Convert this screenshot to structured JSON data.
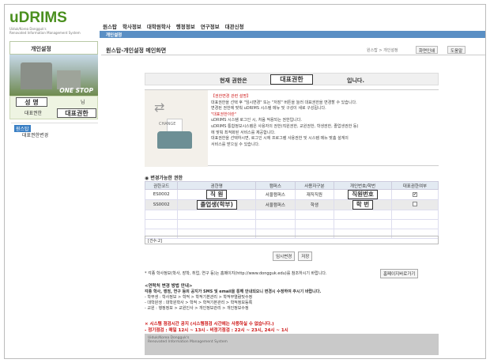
{
  "logo": {
    "name": "uDRIMS",
    "sub1": "Uiduk/Korea Dongguk's",
    "sub2": "Renovated Information Management System"
  },
  "topmenu": [
    "원스탑",
    "학사정보",
    "대학원학사",
    "행정정보",
    "연구정보",
    "대관신청"
  ],
  "navbar": "개인설정",
  "sidebar": {
    "title": "개인설정",
    "photo_caption": "ONE STOP",
    "name": "성 명",
    "name_suffix": "님",
    "role_label": "대표권한",
    "role_value": "대표권한",
    "tree": [
      "원스탑",
      "대표권한변경"
    ]
  },
  "header": {
    "title": "원스탑-개인설정 메인화면",
    "crumb": "원스탑 > 개인설정",
    "buttons": [
      "화면인쇄",
      "도움말"
    ]
  },
  "rolebar": {
    "prefix": "현재 권한은",
    "value": "대표권한",
    "suffix": "입니다."
  },
  "info": {
    "change_label": "CHANGE",
    "lines": [
      {
        "t": "【권한변경 관련 설명】",
        "red": true
      },
      {
        "t": "대표권한을 선택 후 \"임시변경\" 또는 \"저장\" 버튼을 눌러 대표권한을 변경할 수 있습니다.",
        "red": false
      },
      {
        "t": "변경된 권한에 맞춰 uDRIMS 시스템 메뉴 및 구성이 새로 구성됩니다.",
        "red": false
      },
      {
        "t": "\"대표권한이란\"",
        "red": true
      },
      {
        "t": "uDRIMS 시스템 로그인 시, 처음 적용되는 권한입니다.",
        "red": false
      },
      {
        "t": "uDRIMS 통합정보시스템은 사용자의 권한(직원권한, 교원권한, 학생권한, 졸업생권한 등)",
        "red": false
      },
      {
        "t": "에 맞춰 최적화된 서비스를 제공합니다.",
        "red": false
      },
      {
        "t": "대표권한을 선택하시면, 로그인 시에 프로그램 사용권한 및 시스템 메뉴 맞춤 설계의",
        "red": false
      },
      {
        "t": "서비스를 받으실 수 있습니다.",
        "red": false
      }
    ]
  },
  "table": {
    "title": "변경가능한 권한",
    "headers": [
      "권한코드",
      "권한명",
      "캠퍼스",
      "사용자구분",
      "개인번호/학번",
      "대표권한여부"
    ],
    "rows": [
      [
        "ES0002",
        "직 원",
        "서울캠퍼스",
        "재직직원",
        "직원번호",
        true
      ],
      [
        "SS0002",
        "졸업생(학부)",
        "서울캠퍼스",
        "학생",
        "학 번",
        false
      ]
    ],
    "count": "[건수:2]"
  },
  "actions": [
    "임시변경",
    "저장"
  ],
  "note": "* 각종 학사정보(학사, 장학, 취업, 연구 등)는 홈페이지(http://www.dongguk.edu)를 참조하시기 바랍니다.",
  "homepage_button": "홈페이지바로가기",
  "guide": {
    "title": "<연락처 변경 방법 안내>",
    "bold": "각종 학사, 행정, 연구 등의 공지가 SMS 및 email을 통해 안내되오니 변경시 수정하여 주시기 바랍니다.",
    "items": [
      "- 학부생 : 학사정보 > 학적 > 학적기본관리 > 학적부열람및수정",
      "- 대학원생 : 대학원학사 > 학적 > 학적기본관리 > 학적정보등록",
      "- 교원 : 행정정보 > 교원인사 > 개인정보관리 > 개인정보수정"
    ]
  },
  "warn": "× 시스템 점검시간 공지 (시스템점검 시간에는 사용하실 수 없습니다.)",
  "warn2": "- 정기점검 : 매일 12시 ~ 13시   - 비정기점검 : 22시 ~ 23시, 24시 ~ 1시",
  "footer": {
    "l1": "Uiduk/Korea Dongguk's",
    "l2": "Renovated Information Management System"
  }
}
